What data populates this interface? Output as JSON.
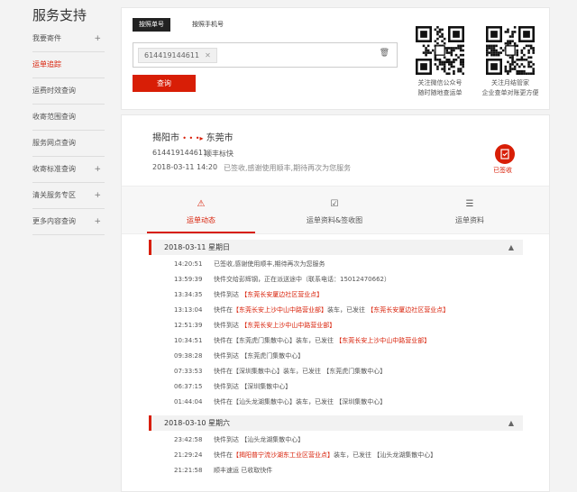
{
  "sidebar": {
    "title": "服务支持",
    "items": [
      {
        "label": "我要寄件",
        "plus": "+"
      },
      {
        "label": "运单追踪",
        "plus": ""
      },
      {
        "label": "运费时效查询",
        "plus": ""
      },
      {
        "label": "收寄范围查询",
        "plus": ""
      },
      {
        "label": "服务网点查询",
        "plus": ""
      },
      {
        "label": "收寄标准查询",
        "plus": "+"
      },
      {
        "label": "清关服务专区",
        "plus": "+"
      },
      {
        "label": "更多内容查询",
        "plus": "+"
      }
    ]
  },
  "search": {
    "tab_waybill": "按照单号",
    "tab_phone": "按照手机号",
    "chip_value": "614419144611",
    "query_label": "查询"
  },
  "qr": {
    "left_caption_1": "关注微信公众号",
    "left_caption_2": "随时随地查运单",
    "right_caption_1": "关注月结管家",
    "right_caption_2": "企业查单对账更方便"
  },
  "shipment": {
    "origin": "揭阳市",
    "dots": "• • •",
    "destination": "东莞市",
    "waybill": "614419144611",
    "service": "顺丰标快",
    "signed_time": "2018-03-11 14:20",
    "signed_msg": "已签收,感谢使用顺丰,期待再次为您服务",
    "status": "已签收"
  },
  "tabs": [
    {
      "label": "运单动态"
    },
    {
      "label": "运单资料&签收图"
    },
    {
      "label": "运单资料"
    }
  ],
  "days": [
    {
      "label": "2018-03-11 星期日",
      "events": [
        {
          "time": "14:20:51",
          "parts": [
            {
              "text": "已签收,感谢使用顺丰,期待再次为您服务",
              "red": false
            }
          ]
        },
        {
          "time": "13:59:39",
          "parts": [
            {
              "text": "快件交给彭辉钢，正在派送途中（联系电话：15012470662）",
              "red": false
            }
          ]
        },
        {
          "time": "13:34:35",
          "parts": [
            {
              "text": "快件到达 ",
              "red": false
            },
            {
              "text": "【东莞长安厦边社区营业点】",
              "red": true
            }
          ]
        },
        {
          "time": "13:13:04",
          "parts": [
            {
              "text": "快件在",
              "red": false
            },
            {
              "text": "【东莞长安上沙中山中路营业部】",
              "red": true
            },
            {
              "text": "装车，已发往 ",
              "red": false
            },
            {
              "text": "【东莞长安厦边社区营业点】",
              "red": true
            }
          ]
        },
        {
          "time": "12:51:39",
          "parts": [
            {
              "text": "快件到达 ",
              "red": false
            },
            {
              "text": "【东莞长安上沙中山中路营业部】",
              "red": true
            }
          ]
        },
        {
          "time": "10:34:51",
          "parts": [
            {
              "text": "快件在【东莞虎门集散中心】装车，已发往 ",
              "red": false
            },
            {
              "text": "【东莞长安上沙中山中路营业部】",
              "red": true
            }
          ]
        },
        {
          "time": "09:38:28",
          "parts": [
            {
              "text": "快件到达 【东莞虎门集散中心】",
              "red": false
            }
          ]
        },
        {
          "time": "07:33:53",
          "parts": [
            {
              "text": "快件在【深圳集散中心】装车，已发往 【东莞虎门集散中心】",
              "red": false
            }
          ]
        },
        {
          "time": "06:37:15",
          "parts": [
            {
              "text": "快件到达 【深圳集散中心】",
              "red": false
            }
          ]
        },
        {
          "time": "01:44:04",
          "parts": [
            {
              "text": "快件在【汕头龙湖集散中心】装车，已发往 【深圳集散中心】",
              "red": false
            }
          ]
        }
      ]
    },
    {
      "label": "2018-03-10 星期六",
      "events": [
        {
          "time": "23:42:58",
          "parts": [
            {
              "text": "快件到达 【汕头龙湖集散中心】",
              "red": false
            }
          ]
        },
        {
          "time": "21:29:24",
          "parts": [
            {
              "text": "快件在",
              "red": false
            },
            {
              "text": "【揭阳普宁流沙湖东工业区营业点】",
              "red": true
            },
            {
              "text": "装车，已发往 【汕头龙湖集散中心】",
              "red": false
            }
          ]
        },
        {
          "time": "21:21:58",
          "parts": [
            {
              "text": "顺丰速运 已收取快件",
              "red": false
            }
          ]
        }
      ]
    }
  ],
  "colors": {
    "accent": "#d81e06"
  }
}
